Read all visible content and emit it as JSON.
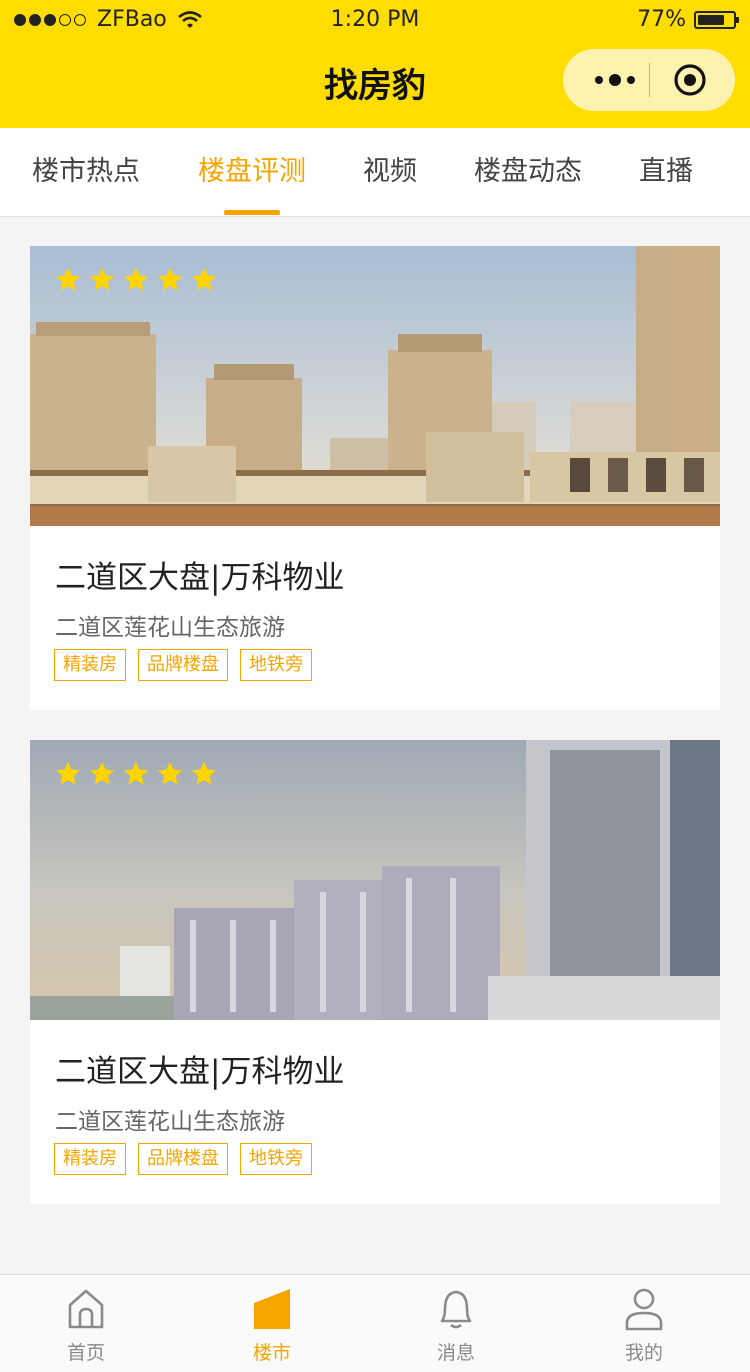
{
  "status_bar": {
    "carrier": "ZFBao",
    "time": "1:20 PM",
    "battery": "77%",
    "battery_level": 0.77
  },
  "navbar": {
    "title": "找房豹"
  },
  "tabs": [
    {
      "label": "楼市热点",
      "active": false
    },
    {
      "label": "楼盘评测",
      "active": true
    },
    {
      "label": "视频",
      "active": false
    },
    {
      "label": "楼盘动态",
      "active": false
    },
    {
      "label": "直播",
      "active": false
    }
  ],
  "cards": [
    {
      "rating": 5,
      "title": "二道区大盘|万科物业",
      "subtitle": "二道区莲花山生态旅游",
      "tags": [
        "精装房",
        "品牌楼盘",
        "地铁旁"
      ]
    },
    {
      "rating": 5,
      "title": "二道区大盘|万科物业",
      "subtitle": "二道区莲花山生态旅游",
      "tags": [
        "精装房",
        "品牌楼盘",
        "地铁旁"
      ]
    }
  ],
  "tabbar": [
    {
      "label": "首页",
      "icon": "home-icon",
      "active": false
    },
    {
      "label": "楼市",
      "icon": "building-icon",
      "active": true
    },
    {
      "label": "消息",
      "icon": "bell-icon",
      "active": false
    },
    {
      "label": "我的",
      "icon": "user-icon",
      "active": false
    }
  ],
  "colors": {
    "brand_yellow": "#ffdd00",
    "accent": "#f5a400",
    "star": "#ffd400"
  }
}
